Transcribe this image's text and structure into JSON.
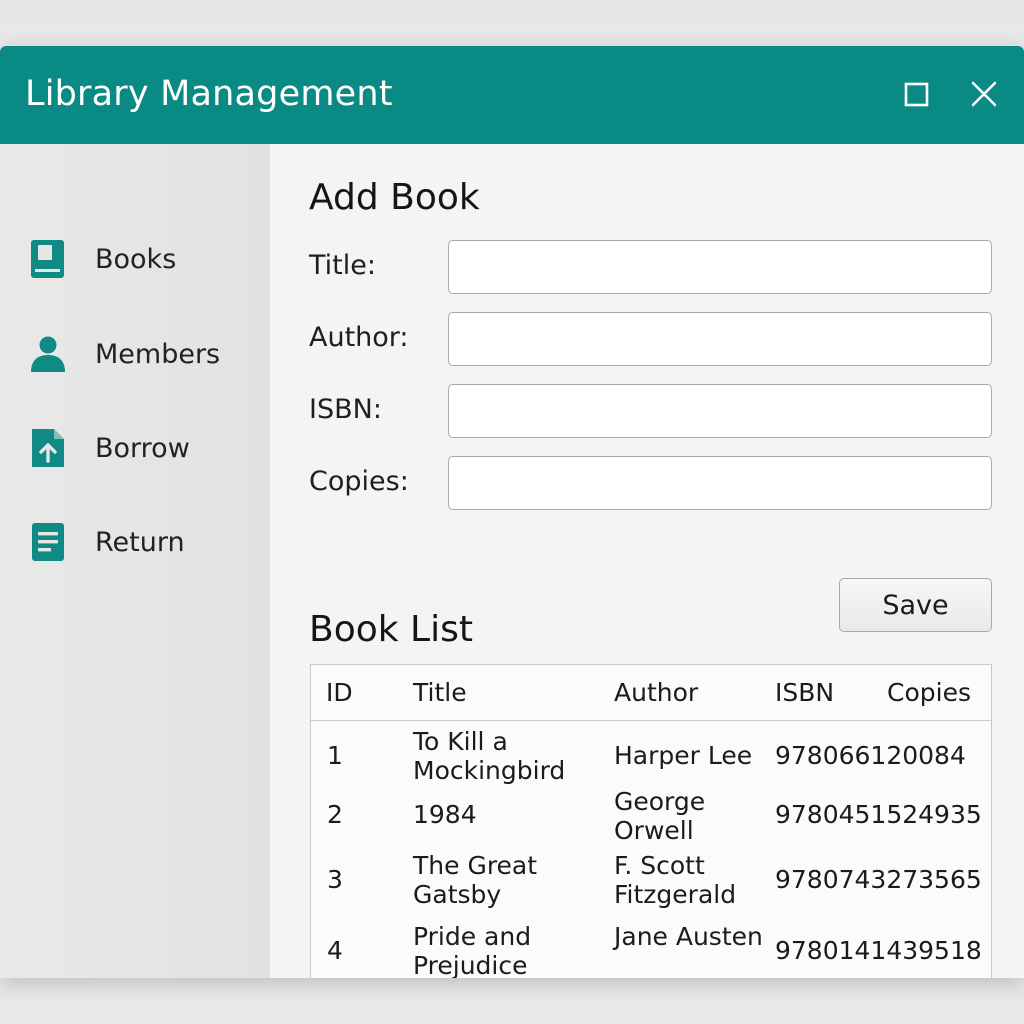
{
  "window": {
    "title": "Library Management",
    "maximize_icon": "maximize-icon",
    "close_icon": "close-icon"
  },
  "colors": {
    "accent": "#0a8a84",
    "sidebar_bg": "#e5e5e4",
    "content_bg": "#f4f4f3"
  },
  "sidebar": {
    "items": [
      {
        "label": "Books",
        "icon": "book-icon"
      },
      {
        "label": "Members",
        "icon": "user-icon"
      },
      {
        "label": "Borrow",
        "icon": "upload-document-icon"
      },
      {
        "label": "Return",
        "icon": "list-document-icon"
      }
    ]
  },
  "form": {
    "heading": "Add Book",
    "fields": [
      {
        "label": "Title:",
        "value": "",
        "placeholder": ""
      },
      {
        "label": "Author:",
        "value": "",
        "placeholder": ""
      },
      {
        "label": "ISBN:",
        "value": "",
        "placeholder": ""
      },
      {
        "label": "Copies:",
        "value": "",
        "placeholder": ""
      }
    ],
    "save_label": "Save"
  },
  "book_list": {
    "heading": "Book List",
    "columns": [
      "ID",
      "Title",
      "Author",
      "ISBN",
      "Copies"
    ],
    "rows": [
      {
        "id": "1",
        "title": "To Kill a Mockingbird",
        "author": "Harper Lee",
        "isbn": "978066120084",
        "copies": ""
      },
      {
        "id": "2",
        "title": "1984",
        "author": "George Orwell",
        "isbn": "9780451524935",
        "copies": ""
      },
      {
        "id": "3",
        "title": "The Great Gatsby",
        "author": "F. Scott Fitzgerald",
        "isbn": "9780743273565",
        "copies": ""
      },
      {
        "id": "4",
        "title": "Pride and Prejudice",
        "author": "Jane Austen",
        "isbn": "9780141439518",
        "copies": ""
      }
    ]
  }
}
